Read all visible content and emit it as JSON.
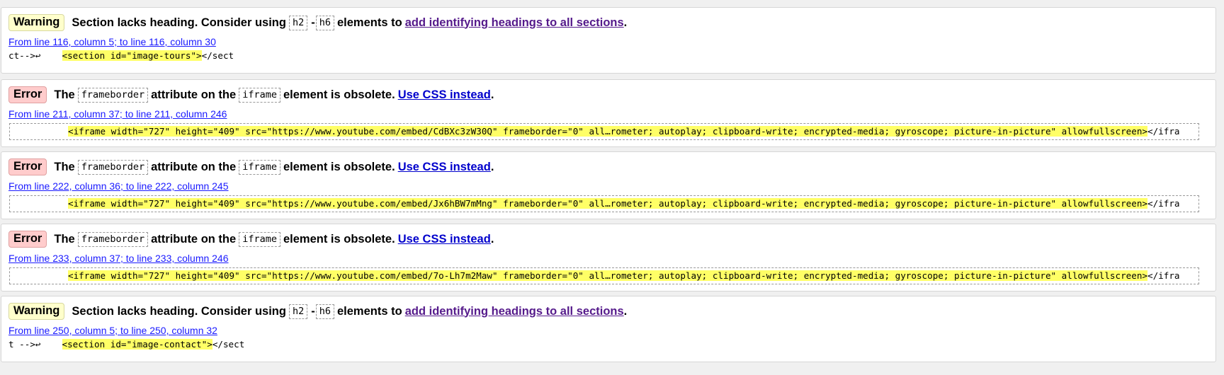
{
  "messages": [
    {
      "type": "Warning",
      "pre": "Section lacks heading. Consider using",
      "chip1": "h2",
      "dash": "-",
      "chip2": "h6",
      "mid": "elements to",
      "link": "add identifying headings to all sections",
      "post": ".",
      "location": "From line 116, column 5; to line 116, column 30",
      "extract_before": "ct-->↩",
      "extract_hl": "<section id=\"image-tours\">",
      "extract_after": "</sect"
    },
    {
      "type": "Error",
      "pre": "The",
      "chip1": "frameborder",
      "mid": "attribute on the",
      "chip2": "iframe",
      "mid2": "element is obsolete.",
      "link": "Use CSS instead",
      "post": ".",
      "location": "From line 211, column 37; to line 211, column 246",
      "extract_hl": "<iframe width=\"727\" height=\"409\" src=\"https://www.youtube.com/embed/CdBXc3zW30Q\" frameborder=\"0\" all…rometer; autoplay; clipboard-write; encrypted-media; gyroscope; picture-in-picture\" allowfullscreen>",
      "extract_after": "</ifra"
    },
    {
      "type": "Error",
      "pre": "The",
      "chip1": "frameborder",
      "mid": "attribute on the",
      "chip2": "iframe",
      "mid2": "element is obsolete.",
      "link": "Use CSS instead",
      "post": ".",
      "location": "From line 222, column 36; to line 222, column 245",
      "extract_hl": "<iframe width=\"727\" height=\"409\" src=\"https://www.youtube.com/embed/Jx6hBW7mMng\" frameborder=\"0\" all…rometer; autoplay; clipboard-write; encrypted-media; gyroscope; picture-in-picture\" allowfullscreen>",
      "extract_after": "</ifra"
    },
    {
      "type": "Error",
      "pre": "The",
      "chip1": "frameborder",
      "mid": "attribute on the",
      "chip2": "iframe",
      "mid2": "element is obsolete.",
      "link": "Use CSS instead",
      "post": ".",
      "location": "From line 233, column 37; to line 233, column 246",
      "extract_hl": "<iframe width=\"727\" height=\"409\" src=\"https://www.youtube.com/embed/7o-Lh7m2Maw\" frameborder=\"0\" all…rometer; autoplay; clipboard-write; encrypted-media; gyroscope; picture-in-picture\" allowfullscreen>",
      "extract_after": "</ifra"
    },
    {
      "type": "Warning",
      "pre": "Section lacks heading. Consider using",
      "chip1": "h2",
      "dash": "-",
      "chip2": "h6",
      "mid": "elements to",
      "link": "add identifying headings to all sections",
      "post": ".",
      "location": "From line 250, column 5; to line 250, column 32",
      "extract_before": "t -->↩",
      "extract_hl": "<section id=\"image-contact\">",
      "extract_after": "</sect"
    }
  ]
}
